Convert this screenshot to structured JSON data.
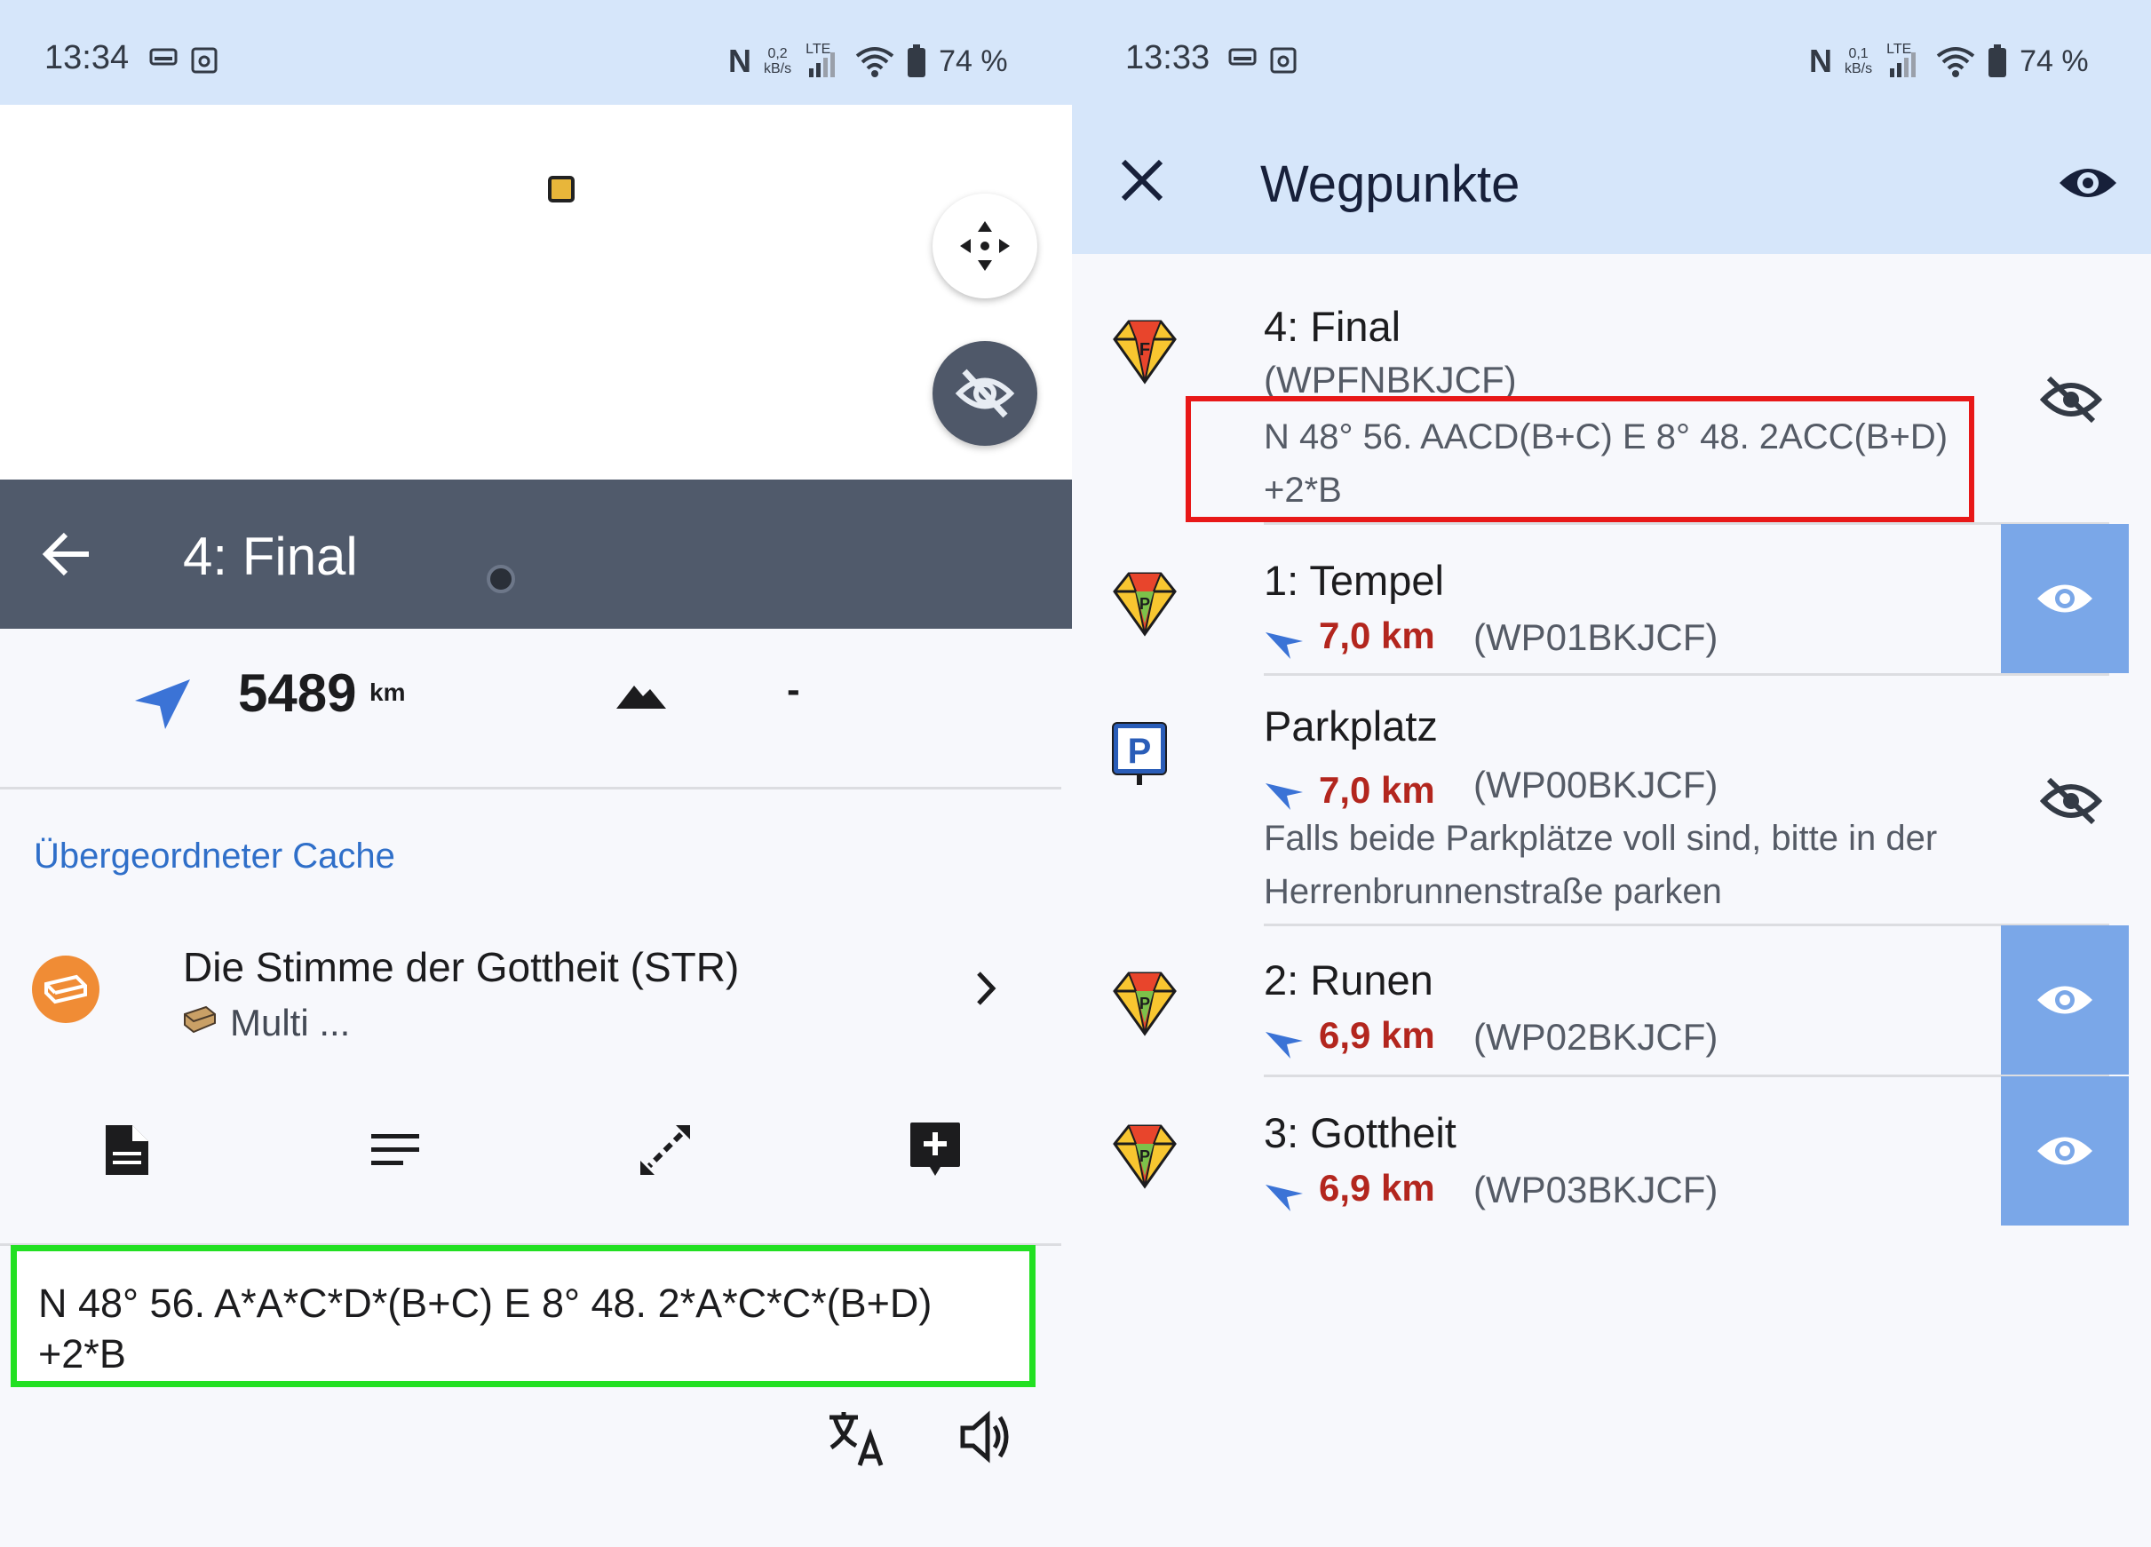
{
  "left": {
    "status": {
      "time": "13:34",
      "rate_top": "0,2",
      "rate_bottom": "kB/s",
      "network": "LTE",
      "battery": "74 %"
    },
    "title": "4: Final",
    "distance": {
      "value": "5489",
      "unit": "km"
    },
    "elevation": "-",
    "section_title": "Übergeordneter Cache",
    "parent_cache": {
      "name": "Die Stimme der Gottheit (STR)",
      "type": "Multi ..."
    },
    "coordinates": "N 48° 56. A*A*C*D*(B+C) E 8° 48. 2*A*C*C*(B+D) +2*B",
    "icons": {
      "back": "back-arrow-icon",
      "center": "center-map-icon",
      "hide": "eye-off-icon",
      "navigate": "navigation-arrow-icon",
      "elevation": "mountain-icon",
      "cache": "cache-icon",
      "chevron": "chevron-right-icon",
      "actions": [
        "document-icon",
        "description-icon",
        "expand-icon",
        "add-note-icon"
      ],
      "translate": "translate-icon",
      "speak": "speaker-icon"
    }
  },
  "right": {
    "status": {
      "time": "13:33",
      "rate_top": "0,1",
      "rate_bottom": "kB/s",
      "network": "LTE",
      "battery": "74 %"
    },
    "title": "Wegpunkte",
    "waypoints": [
      {
        "name": "4: Final",
        "code": "(WPFNBKJCF)",
        "coords": "N 48° 56. AACD(B+C) E 8° 48. 2ACC(B+D) +2*B",
        "visible": false
      },
      {
        "name": "1: Tempel",
        "distance": "7,0 km",
        "code": "(WP01BKJCF)",
        "visible": true
      },
      {
        "name": "Parkplatz",
        "distance": "7,0 km",
        "code": "(WP00BKJCF)",
        "note": "Falls beide Parkplätze voll sind, bitte in der Herrenbrunnenstraße parken",
        "visible": false
      },
      {
        "name": "2: Runen",
        "distance": "6,9 km",
        "code": "(WP02BKJCF)",
        "visible": true
      },
      {
        "name": "3: Gottheit",
        "distance": "6,9 km",
        "code": "(WP03BKJCF)",
        "visible": true
      }
    ],
    "colors": {
      "eye_on_bg": "#7aa7e8",
      "distance": "#b3261e",
      "highlight_red": "#e81818",
      "highlight_green": "#22e022"
    }
  }
}
